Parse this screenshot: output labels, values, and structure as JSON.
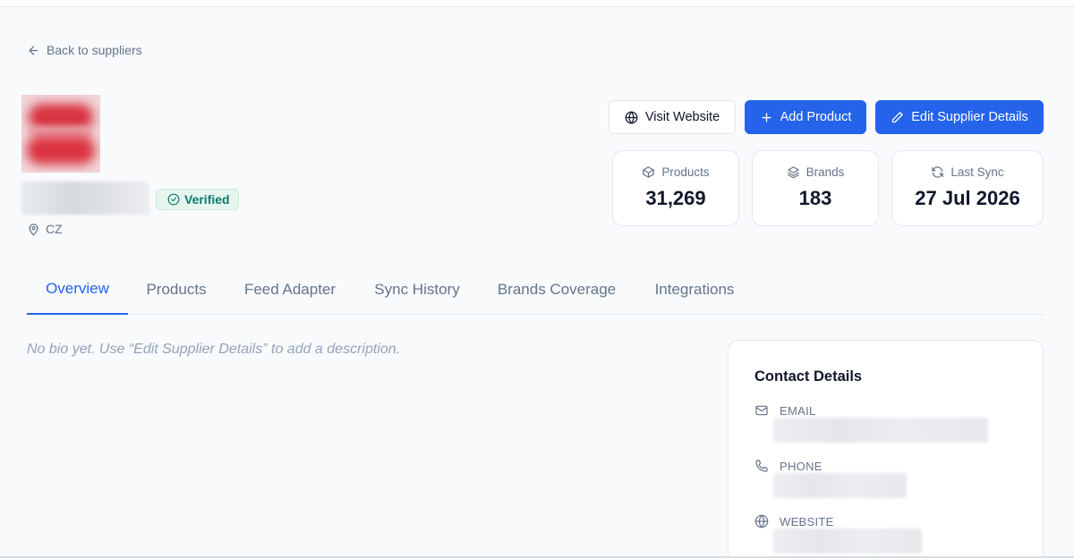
{
  "nav": {
    "back_label": "Back to suppliers"
  },
  "supplier": {
    "verified_label": "Verified",
    "country": "CZ"
  },
  "actions": {
    "visit_website": "Visit Website",
    "add_product": "Add Product",
    "edit_supplier": "Edit Supplier Details"
  },
  "stats": {
    "products": {
      "label": "Products",
      "value": "31,269"
    },
    "brands": {
      "label": "Brands",
      "value": "183"
    },
    "last_sync": {
      "label": "Last Sync",
      "value": "27 Jul 2026"
    }
  },
  "tabs": [
    {
      "label": "Overview",
      "active": true
    },
    {
      "label": "Products"
    },
    {
      "label": "Feed Adapter"
    },
    {
      "label": "Sync History"
    },
    {
      "label": "Brands Coverage"
    },
    {
      "label": "Integrations"
    }
  ],
  "overview": {
    "bio_placeholder": "No bio yet. Use “Edit Supplier Details” to add a description."
  },
  "contact": {
    "title": "Contact Details",
    "email_label": "EMAIL",
    "phone_label": "PHONE",
    "website_label": "WEBSITE"
  },
  "colors": {
    "primary": "#2563eb",
    "verified_bg": "#e6f6ef",
    "verified_text": "#0f766e",
    "muted_text": "#64748b"
  }
}
